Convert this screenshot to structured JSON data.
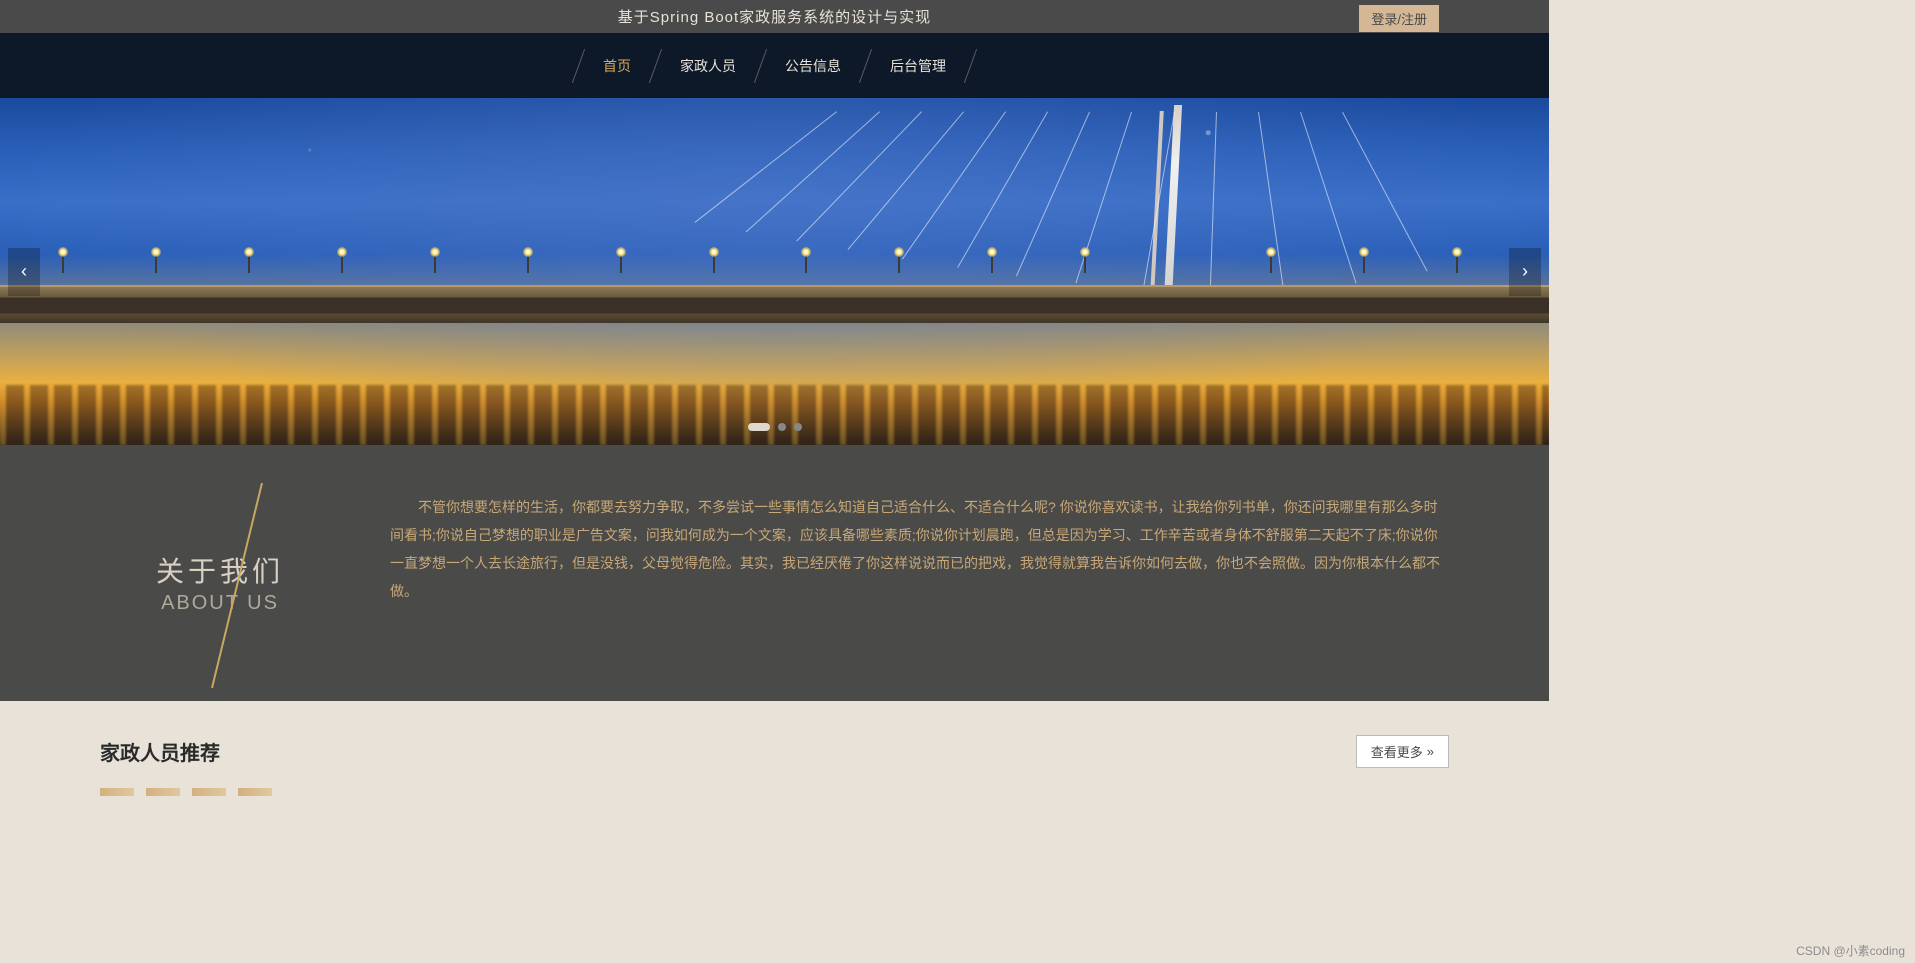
{
  "header": {
    "title": "基于Spring Boot家政服务系统的设计与实现",
    "login_label": "登录/注册"
  },
  "nav": {
    "items": [
      {
        "label": "首页",
        "active": true
      },
      {
        "label": "家政人员",
        "active": false
      },
      {
        "label": "公告信息",
        "active": false
      },
      {
        "label": "后台管理",
        "active": false
      }
    ]
  },
  "carousel": {
    "prev_icon": "‹",
    "next_icon": "›",
    "active_index": 0,
    "dot_count": 3
  },
  "about": {
    "title_cn": "关于我们",
    "title_en": "ABOUT US",
    "body": "不管你想要怎样的生活，你都要去努力争取，不多尝试一些事情怎么知道自己适合什么、不适合什么呢? 你说你喜欢读书，让我给你列书单，你还问我哪里有那么多时间看书;你说自己梦想的职业是广告文案，问我如何成为一个文案，应该具备哪些素质;你说你计划晨跑，但总是因为学习、工作辛苦或者身体不舒服第二天起不了床;你说你一直梦想一个人去长途旅行，但是没钱，父母觉得危险。其实，我已经厌倦了你这样说说而已的把戏，我觉得就算我告诉你如何去做，你也不会照做。因为你根本什么都不做。"
  },
  "recommend": {
    "title": "家政人员推荐",
    "view_more_label": "查看更多",
    "view_more_icon": "»"
  },
  "watermark": "CSDN @小素coding"
}
